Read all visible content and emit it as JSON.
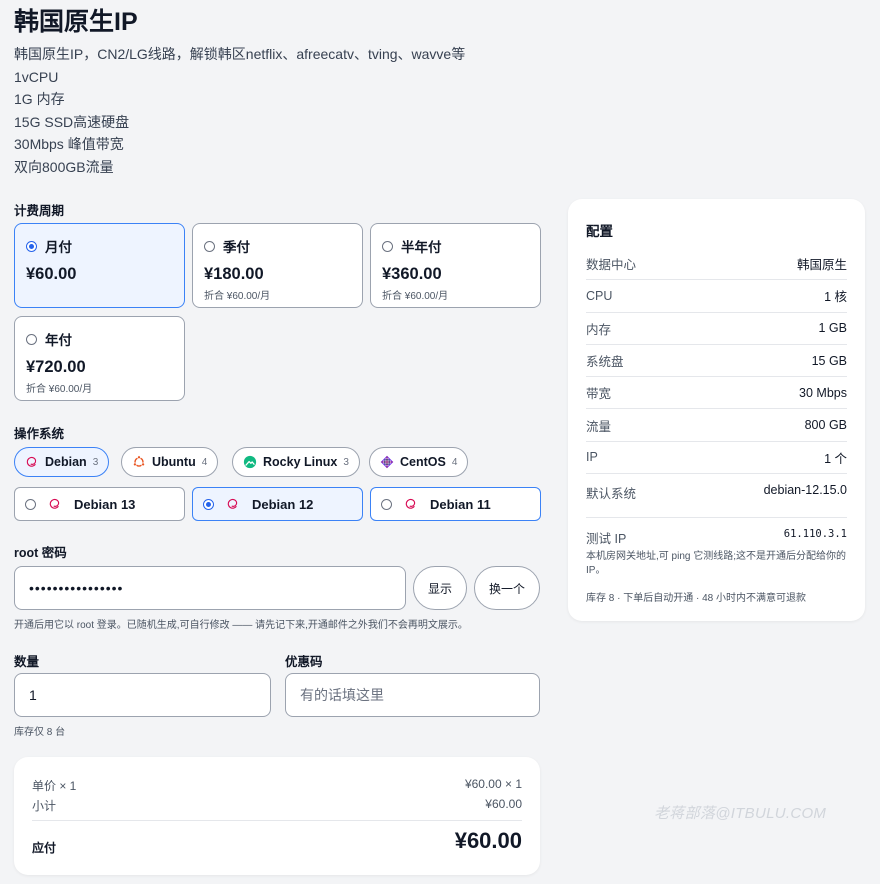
{
  "product": {
    "title": "韩国原生IP",
    "desc": [
      "韩国原生IP，CN2/LG线路，解锁韩区netflix、afreecatv、tving、wavve等",
      "1vCPU",
      "1G 内存",
      "15G SSD高速硬盘",
      "30Mbps 峰值带宽",
      "双向800GB流量"
    ]
  },
  "billing": {
    "label": "计费周期",
    "options": [
      {
        "name": "月付",
        "price": "¥60.00",
        "note": "",
        "selected": true
      },
      {
        "name": "季付",
        "price": "¥180.00",
        "note": "折合 ¥60.00/月",
        "selected": false
      },
      {
        "name": "半年付",
        "price": "¥360.00",
        "note": "折合 ¥60.00/月",
        "selected": false
      },
      {
        "name": "年付",
        "price": "¥720.00",
        "note": "折合 ¥60.00/月",
        "selected": false
      }
    ]
  },
  "os": {
    "label": "操作系统",
    "families": [
      {
        "name": "Debian",
        "count": "3",
        "icon": "debian-icon",
        "selected": true
      },
      {
        "name": "Ubuntu",
        "count": "4",
        "icon": "ubuntu-icon",
        "selected": false
      },
      {
        "name": "Rocky Linux",
        "count": "3",
        "icon": "rocky-linux-icon",
        "selected": false
      },
      {
        "name": "CentOS",
        "count": "4",
        "icon": "centos-icon",
        "selected": false
      }
    ],
    "versions": [
      {
        "name": "Debian 13",
        "selected": false
      },
      {
        "name": "Debian 12",
        "selected": true
      },
      {
        "name": "Debian 11",
        "selected": false
      }
    ]
  },
  "root": {
    "label": "root 密码",
    "value": "••••••••••••••••",
    "show_label": "显示",
    "regen_label": "换一个",
    "hint": "开通后用它以 root 登录。已随机生成,可自行修改 —— 请先记下来,开通邮件之外我们不会再明文展示。"
  },
  "quantity": {
    "label": "数量",
    "value": "1",
    "hint": "库存仅 8 台"
  },
  "coupon": {
    "label": "优惠码",
    "placeholder": "有的话填这里"
  },
  "summary": {
    "unit_label": "单价 × 1",
    "unit_value": "¥60.00 × 1",
    "subtotal_label": "小计",
    "subtotal_value": "¥60.00",
    "total_label": "应付",
    "total_value": "¥60.00"
  },
  "config": {
    "title": "配置",
    "rows": [
      {
        "k": "数据中心",
        "v": "韩国原生"
      },
      {
        "k": "CPU",
        "v": "1 核"
      },
      {
        "k": "内存",
        "v": "1 GB"
      },
      {
        "k": "系统盘",
        "v": "15 GB"
      },
      {
        "k": "带宽",
        "v": "30 Mbps"
      },
      {
        "k": "流量",
        "v": "800 GB"
      },
      {
        "k": "IP",
        "v": "1 个"
      },
      {
        "k": "默认系统",
        "v": "debian-12.15.0"
      }
    ],
    "test_ip_label": "测试 IP",
    "test_ip_value": "61.110.3.1",
    "test_ip_note": "本机房网关地址,可 ping 它测线路;这不是开通后分配给你的 IP。",
    "stock_note": "库存 8 · 下单后自动开通 · 48 小时内不满意可退款"
  },
  "watermark": "老蒋部落@ITBULU.COM",
  "colors": {
    "accent": "#2563eb",
    "selected_bg": "#eef4ff",
    "background": "#f3f4f6"
  }
}
